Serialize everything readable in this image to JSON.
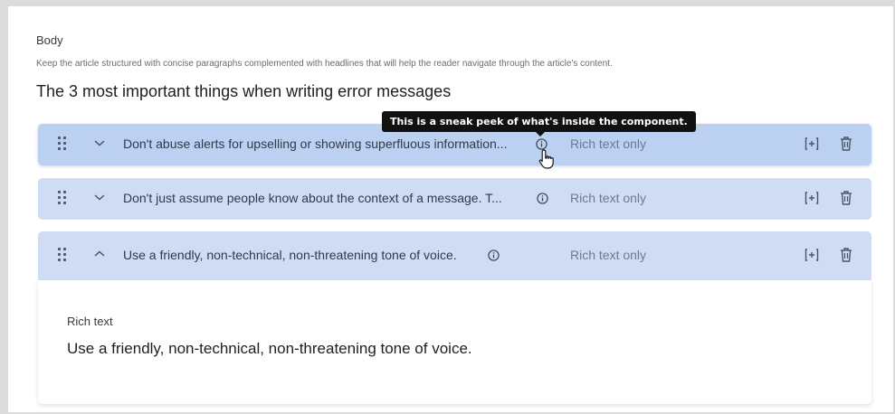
{
  "body_field": {
    "label": "Body",
    "hint": "Keep the article structured with concise paragraphs complemented with headlines that will help the reader navigate through the article's content.",
    "title": "The 3 most important things when writing error messages"
  },
  "tooltip": {
    "text": "This is a sneak peek of what's inside the component."
  },
  "rows": [
    {
      "title": "Don't abuse alerts for upselling or showing superfluous information...",
      "type": "Rich text only",
      "state": "collapsed"
    },
    {
      "title": "Don't just assume people know about the context of a message. T...",
      "type": "Rich text only",
      "state": "collapsed"
    },
    {
      "title": "Use a friendly, non-technical, non-threatening tone of voice.",
      "type": "Rich text only",
      "state": "expanded"
    }
  ],
  "expanded": {
    "field_label": "Rich text",
    "field_value": "Use a friendly, non-technical, non-threatening tone of voice."
  },
  "icons": {
    "drag": "drag-handle-icon",
    "chevron_down": "chevron-down-icon",
    "chevron_up": "chevron-up-icon",
    "info": "info-icon",
    "copy": "duplicate-icon",
    "trash": "trash-icon",
    "cursor": "pointer-hand-cursor-icon"
  },
  "colors": {
    "row_bg": "#cfdcf3",
    "row_active_bg": "#bcd0f1",
    "tooltip_bg": "#111111"
  }
}
